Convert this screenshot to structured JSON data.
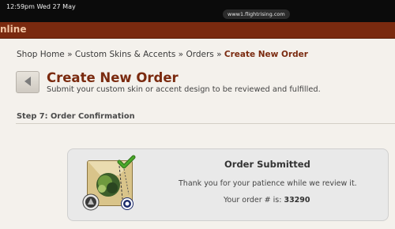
{
  "status_bar": {
    "time_date": "12:59pm  Wed 27 May",
    "url": "www1.flightrising.com"
  },
  "topbar": {
    "text": "nline"
  },
  "breadcrumb": {
    "home": "Shop Home",
    "sep1": " » ",
    "category": "Custom Skins & Accents",
    "sep2": " » ",
    "orders": "Orders",
    "sep3": " » ",
    "current": "Create New Order"
  },
  "header": {
    "title": "Create New Order",
    "subtitle": "Submit your custom skin or accent design to be reviewed and fulfilled."
  },
  "step": {
    "heading": "Step 7: Order Confirmation"
  },
  "confirmation": {
    "title": "Order Submitted",
    "thanks": "Thank you for your patience while we review it.",
    "order_label": "Your order # is: ",
    "order_number": "33290"
  },
  "icons": {
    "back": "back-arrow-icon",
    "check": "checkmark-icon",
    "left_badge": "gender-badge-icon",
    "right_badge": "accent-badge-icon"
  },
  "colors": {
    "brand": "#7a2a0f",
    "topbar_text": "#f2c7a5",
    "background": "#f4f1ec",
    "check_green": "#4aa82a"
  }
}
